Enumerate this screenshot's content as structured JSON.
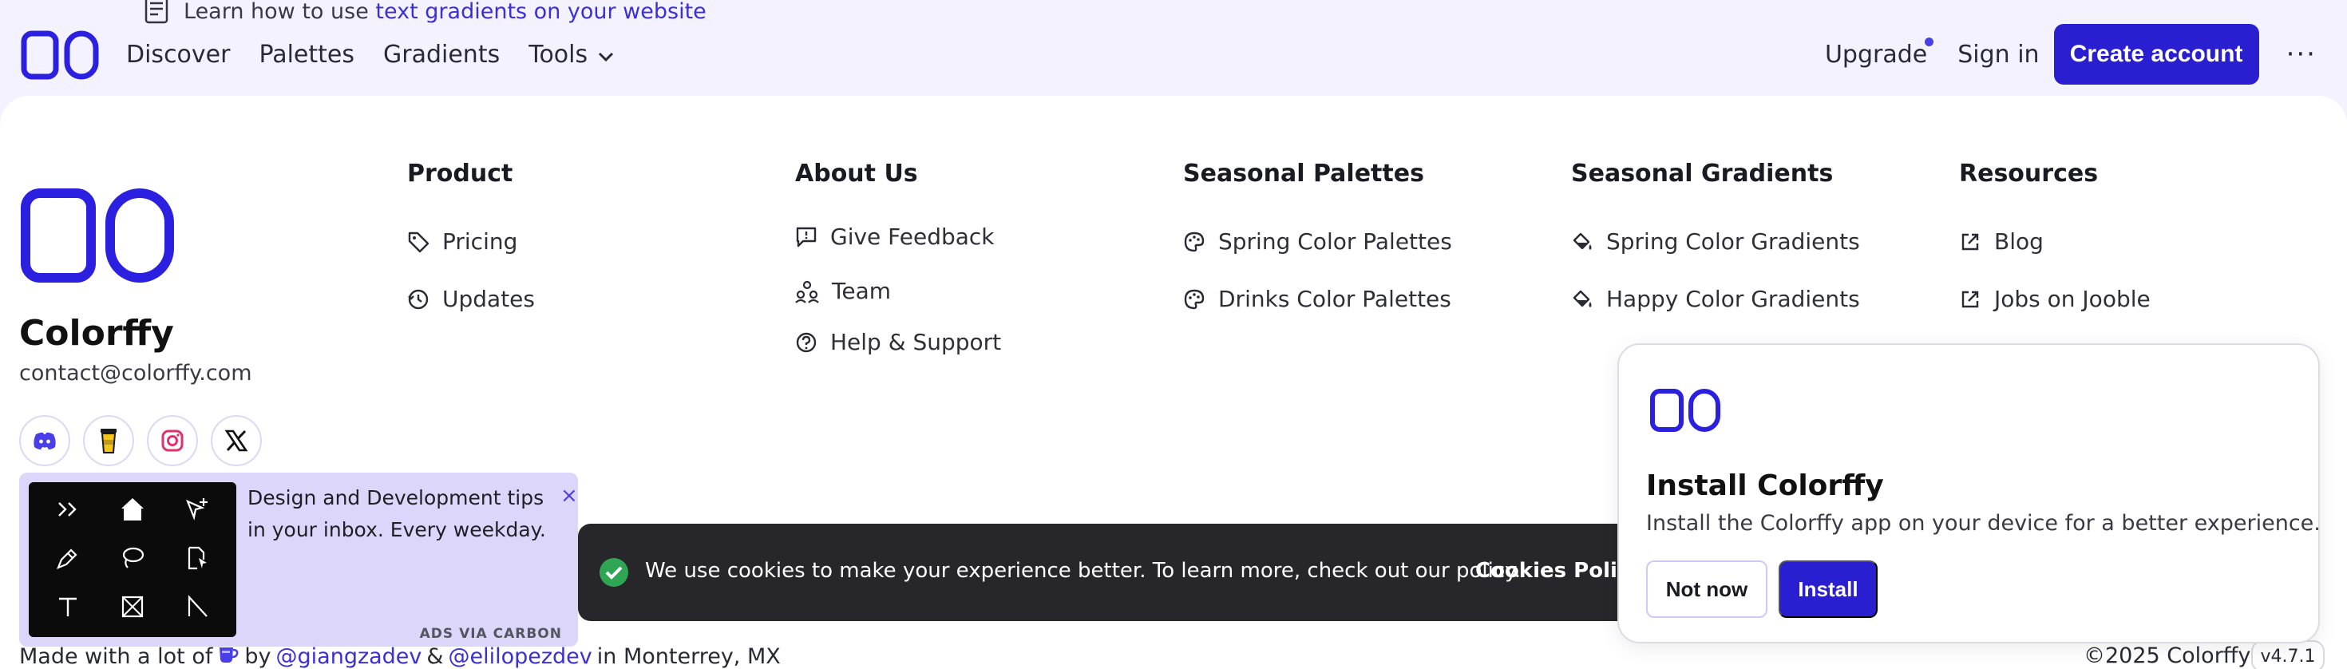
{
  "tip": {
    "prefix": "Learn how to use",
    "link": "text gradients on your website",
    "icon": "document-icon"
  },
  "header": {
    "nav": [
      "Discover",
      "Palettes",
      "Gradients",
      "Tools"
    ],
    "upgrade": "Upgrade",
    "sign_in": "Sign in",
    "create_account": "Create account",
    "more": "···"
  },
  "brand": {
    "name": "Colorffy",
    "email": "contact@colorffy.com",
    "socials": [
      "discord-icon",
      "coffee-cup-icon",
      "instagram-icon",
      "x-icon"
    ]
  },
  "columns": [
    {
      "title": "Product",
      "links": [
        "Pricing",
        "Updates"
      ]
    },
    {
      "title": "About Us",
      "links": [
        "Give Feedback",
        "Team",
        "Help & Support"
      ]
    },
    {
      "title": "Seasonal Palettes",
      "links": [
        "Spring Color Palettes",
        "Drinks Color Palettes"
      ]
    },
    {
      "title": "Seasonal Gradients",
      "links": [
        "Spring Color Gradients",
        "Happy Color Gradients"
      ]
    },
    {
      "title": "Resources",
      "links": [
        "Blog",
        "Jobs on Jooble"
      ]
    }
  ],
  "ad": {
    "text": "Design and Development tips in your inbox. Every weekday.",
    "close": "×",
    "via": "ADS VIA CARBON"
  },
  "footer": {
    "made_prefix": "Made with a lot of",
    "by": "by",
    "author1": "@giangzadev",
    "amp": "&",
    "author2": "@elilopezdev",
    "location": "in Monterrey, MX",
    "copyright": "©2025 Colorffy",
    "version": "v4.7.1"
  },
  "cookie": {
    "message": "We use cookies to make your experience better. To learn more, check out our policy.",
    "policy_link": "Cookies Policy"
  },
  "install": {
    "title": "Install Colorffy",
    "description": "Install the Colorffy app on your device for a better experience.",
    "not_now": "Not now",
    "install": "Install"
  },
  "colors": {
    "accent": "#2a1fd0",
    "link": "#3b2fd6",
    "background": "#f4f2ff"
  }
}
